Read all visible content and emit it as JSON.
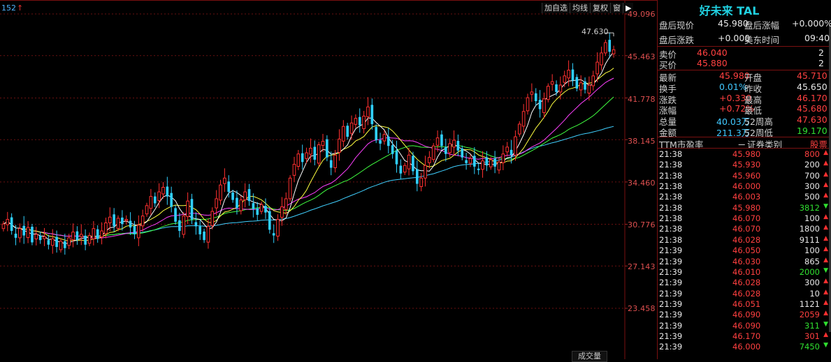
{
  "chart": {
    "period": "152",
    "period_arrow": "↑",
    "toolbar": [
      "加自选",
      "均线",
      "复权",
      "窗",
      "▶"
    ],
    "y_ticks": [
      "49.096",
      "45.463",
      "41.778",
      "38.145",
      "34.460",
      "30.776",
      "27.143",
      "23.458"
    ],
    "high_label": "47.630",
    "volume_tab": "成交量"
  },
  "chart_data": {
    "type": "candlestick",
    "ylim": [
      23.458,
      49.096
    ],
    "y_ticks": [
      49.096,
      45.463,
      41.778,
      38.145,
      34.46,
      30.776,
      27.143,
      23.458
    ],
    "high_marker": 47.63,
    "colors": {
      "up": "#ff3030",
      "down": "#30d0ff",
      "ma5": "#ffffff",
      "ma10": "#ffff40",
      "ma20": "#ff40ff",
      "ma30": "#40ff40",
      "ma60": "#40d0ff"
    },
    "closes": [
      30.8,
      31.2,
      30.2,
      29.6,
      30.4,
      29.8,
      30.5,
      29.2,
      29.9,
      29.4,
      29.7,
      29.0,
      29.5,
      28.8,
      29.3,
      28.7,
      29.6,
      30.1,
      29.4,
      29.9,
      29.0,
      29.8,
      30.4,
      29.5,
      30.2,
      30.9,
      31.4,
      30.6,
      31.3,
      30.8,
      31.2,
      30.5,
      29.9,
      30.7,
      31.5,
      32.4,
      33.2,
      32.6,
      33.6,
      34.0,
      33.2,
      32.3,
      31.0,
      30.2,
      31.5,
      32.8,
      31.2,
      30.6,
      29.9,
      29.4,
      30.6,
      31.9,
      33.0,
      34.2,
      34.8,
      33.6,
      32.9,
      32.2,
      32.9,
      33.6,
      32.8,
      32.1,
      31.6,
      32.5,
      31.8,
      30.3,
      29.8,
      31.2,
      32.3,
      33.0,
      34.8,
      36.0,
      36.9,
      36.2,
      37.0,
      37.4,
      36.4,
      37.7,
      38.0,
      36.6,
      35.7,
      36.8,
      38.2,
      39.3,
      38.4,
      39.6,
      40.0,
      39.4,
      40.2,
      41.0,
      39.5,
      38.1,
      37.8,
      38.6,
      37.6,
      36.9,
      36.0,
      35.2,
      35.9,
      36.8,
      35.4,
      34.3,
      34.8,
      35.9,
      36.6,
      37.6,
      38.3,
      37.6,
      36.9,
      37.8,
      38.1,
      37.2,
      36.6,
      36.1,
      36.5,
      35.8,
      35.5,
      36.3,
      35.9,
      36.4,
      35.8,
      36.2,
      36.9,
      37.5,
      36.8,
      38.4,
      39.5,
      40.6,
      41.8,
      42.3,
      41.5,
      40.8,
      41.7,
      42.8,
      43.2,
      42.3,
      42.9,
      43.7,
      44.2,
      43.3,
      42.6,
      43.1,
      42.5,
      42.9,
      43.7,
      44.9,
      45.7,
      46.6,
      45.8,
      45.98
    ]
  },
  "quote": {
    "title": "好未来 TAL",
    "after_hours": [
      {
        "l1": "盘后现价",
        "v1": "45.980",
        "l2": "盘后涨幅",
        "v2": "+0.000%"
      },
      {
        "l1": "盘后涨跌",
        "v1": "+0.000",
        "l2": "美东时间",
        "v2": "09:40"
      }
    ],
    "book": [
      {
        "label": "卖价",
        "price": "46.040",
        "qty": "2"
      },
      {
        "label": "买价",
        "price": "45.880",
        "qty": "2"
      }
    ],
    "stats": [
      {
        "l1": "最新",
        "v1": "45.980",
        "c1": "red",
        "l2": "开盘",
        "v2": "45.710",
        "c2": "red"
      },
      {
        "l1": "换手",
        "v1": "0.01%",
        "c1": "cyn",
        "l2": "昨收",
        "v2": "45.650",
        "c2": "wht"
      },
      {
        "l1": "涨跌",
        "v1": "+0.330",
        "c1": "red",
        "l2": "最高",
        "v2": "46.170",
        "c2": "red"
      },
      {
        "l1": "涨幅",
        "v1": "+0.72%",
        "c1": "red",
        "l2": "最低",
        "v2": "45.680",
        "c2": "red"
      },
      {
        "l1": "总量",
        "v1": "40.03万",
        "c1": "cyn",
        "l2": "52周高",
        "v2": "47.630",
        "c2": "red"
      },
      {
        "l1": "金额",
        "v1": "211.3万",
        "c1": "cyn",
        "l2": "52周低",
        "v2": "19.170",
        "c2": "grn"
      }
    ],
    "ttm": {
      "l1": "TTM市盈率",
      "v1": "－",
      "l2": "证券类别",
      "v2": "股票"
    },
    "ticks": [
      {
        "time": "21:38",
        "price": "45.980",
        "vol": "800",
        "dir": "up"
      },
      {
        "time": "21:38",
        "price": "45.930",
        "vol": "200",
        "dir": "up"
      },
      {
        "time": "21:38",
        "price": "45.960",
        "vol": "700",
        "dir": "up"
      },
      {
        "time": "21:38",
        "price": "46.000",
        "vol": "300",
        "dir": "up"
      },
      {
        "time": "21:38",
        "price": "46.003",
        "vol": "500",
        "dir": "up"
      },
      {
        "time": "21:38",
        "price": "45.980",
        "vol": "3812",
        "dir": "down"
      },
      {
        "time": "21:38",
        "price": "46.070",
        "vol": "100",
        "dir": "up"
      },
      {
        "time": "21:38",
        "price": "46.070",
        "vol": "1800",
        "dir": "up"
      },
      {
        "time": "21:38",
        "price": "46.028",
        "vol": "9111",
        "dir": "up"
      },
      {
        "time": "21:39",
        "price": "46.050",
        "vol": "100",
        "dir": "up"
      },
      {
        "time": "21:39",
        "price": "46.030",
        "vol": "865",
        "dir": "up"
      },
      {
        "time": "21:39",
        "price": "46.010",
        "vol": "2000",
        "dir": "down"
      },
      {
        "time": "21:39",
        "price": "46.028",
        "vol": "300",
        "dir": "up"
      },
      {
        "time": "21:39",
        "price": "46.028",
        "vol": "10",
        "dir": "up"
      },
      {
        "time": "21:39",
        "price": "46.051",
        "vol": "1121",
        "dir": "up"
      },
      {
        "time": "21:39",
        "price": "46.090",
        "vol": "2059",
        "dir": "up"
      },
      {
        "time": "21:39",
        "price": "46.090",
        "vol": "311",
        "dir": "down"
      },
      {
        "time": "21:39",
        "price": "46.170",
        "vol": "301",
        "dir": "up"
      },
      {
        "time": "21:39",
        "price": "46.000",
        "vol": "7450",
        "dir": "down"
      }
    ]
  }
}
